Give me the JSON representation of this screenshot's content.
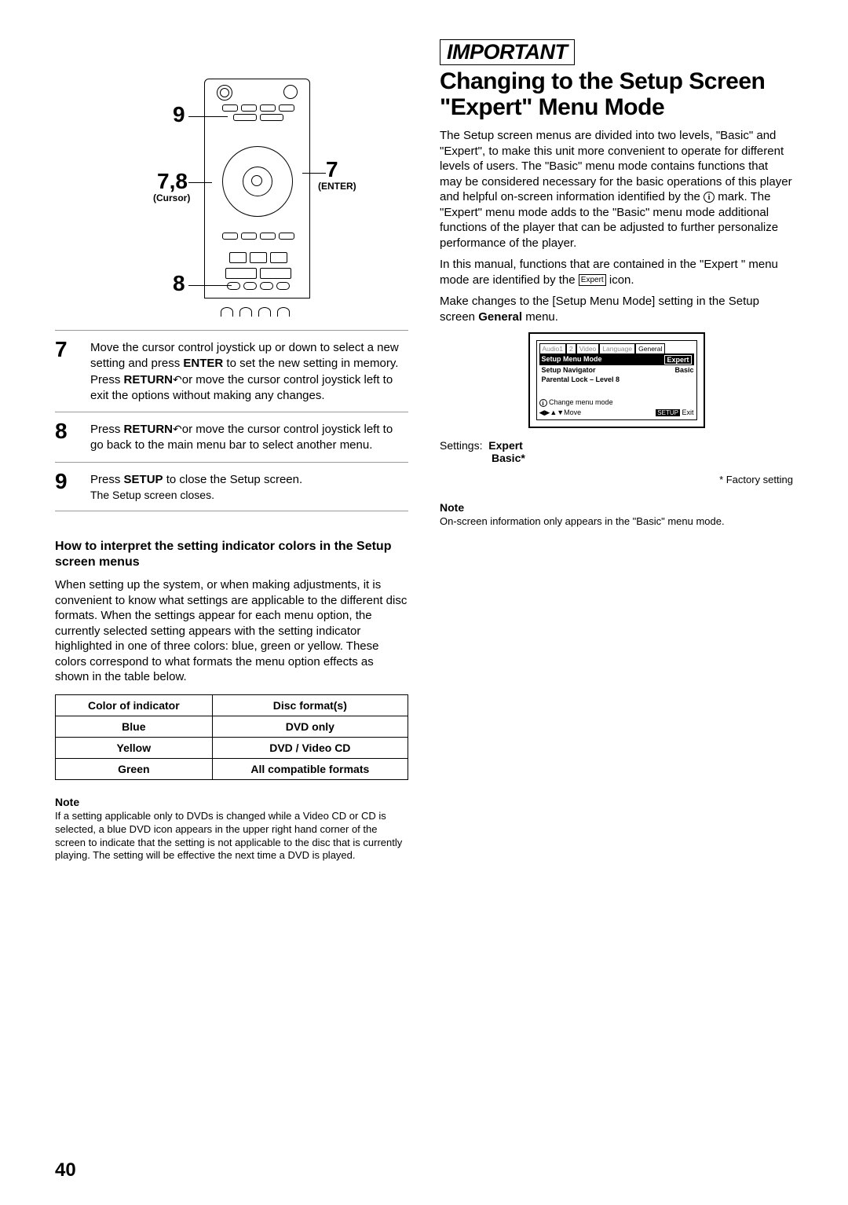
{
  "diagram": {
    "l9": "9",
    "l78": "7,8",
    "lcursor": "(Cursor)",
    "l7": "7",
    "lenter": "(ENTER)",
    "l8": "8"
  },
  "steps": {
    "s7": {
      "num": "7",
      "text_parts": {
        "a": "Move the cursor control joystick up or down to select a new  setting and press ",
        "enter": "ENTER",
        "b": " to set the new setting in memory. Press ",
        "return": "RETURN",
        "icon": " ↶ ",
        "c": "or move the cursor control joystick left to exit the options without making any changes."
      }
    },
    "s8": {
      "num": "8",
      "text_parts": {
        "a": "Press ",
        "return": "RETURN",
        "icon": " ↶ ",
        "b": "or move the cursor control joystick left to go back to the main menu bar to select another menu."
      }
    },
    "s9": {
      "num": "9",
      "text_parts": {
        "a": "Press ",
        "setup": "SETUP",
        "b": " to close the Setup screen."
      },
      "sub": "The Setup screen closes."
    }
  },
  "indicator": {
    "heading": "How to interpret the setting indicator colors in the Setup screen menus",
    "body": "When setting up the system, or when making adjustments, it is convenient to know what settings are applicable to the different disc formats. When the settings appear for each menu option, the currently selected setting appears with the setting indicator highlighted in one of three colors: blue, green or yellow. These colors correspond to what formats the menu option effects as shown in the table below.",
    "th1": "Color of indicator",
    "th2": "Disc format(s)",
    "rows": [
      {
        "c": "Blue",
        "f": "DVD only"
      },
      {
        "c": "Yellow",
        "f": "DVD / Video CD"
      },
      {
        "c": "Green",
        "f": "All compatible formats"
      }
    ]
  },
  "note1": {
    "heading": "Note",
    "text": "If a setting applicable only to DVDs is changed while a Video CD or CD is selected, a blue DVD icon appears in the upper right hand corner of the screen to indicate that the setting is not applicable to the disc that is currently playing. The setting will be effective the next time a DVD is played."
  },
  "right": {
    "important": "IMPORTANT",
    "heading": "Changing to the Setup Screen \"Expert\" Menu Mode",
    "p1a": "The Setup screen menus are divided into two levels, \"Basic\" and \"Expert\", to make this unit more convenient to operate for different levels of users. The \"Basic\" menu mode contains functions that may be considered necessary for the basic operations of this player and helpful on-screen information identified by the ",
    "p1b": " mark. The \"Expert\" menu mode adds to the \"Basic\" menu mode additional functions of the player that can be adjusted to further personalize performance of the player.",
    "p2a": "In this manual, functions that are contained in the \"Expert \" menu mode are identified by the ",
    "p2_icon": "Expert",
    "p2b": " icon.",
    "p3a": "Make changes to the [Setup Menu Mode] setting in the Setup screen ",
    "p3_general": "General",
    "p3b": " menu.",
    "screen": {
      "tabs": [
        "Audio1",
        "2",
        "Video",
        "Language",
        "General"
      ],
      "rows": [
        {
          "label": "Setup Menu Mode",
          "val": "Expert",
          "sel": true,
          "boxed": true
        },
        {
          "label": "Setup Navigator",
          "val": "Basic"
        },
        {
          "label": "Parental Lock – Level 8",
          "val": ""
        }
      ],
      "hint": "Change menu mode",
      "move": "Move",
      "setup": "SETUP",
      "exit": "Exit"
    },
    "settings_label": "Settings:",
    "settings_expert": "Expert",
    "settings_basic": "Basic*",
    "factory": "* Factory setting",
    "note_heading": "Note",
    "note_text": "On-screen information only appears in the \"Basic\" menu mode."
  },
  "page_num": "40"
}
